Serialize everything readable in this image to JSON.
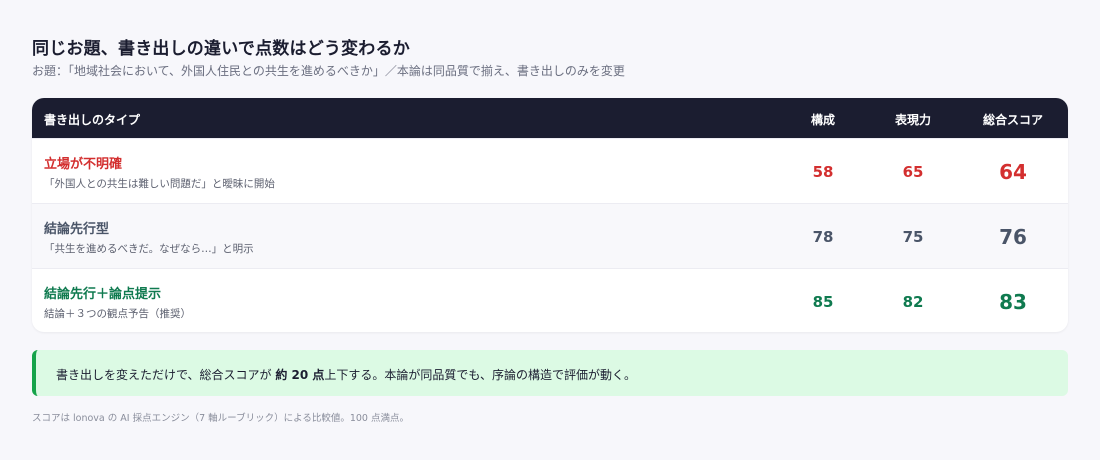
{
  "title": "同じお題、書き出しの違いで点数はどう変わるか",
  "subtitle": "お題：「地域社会において、外国人住民との共生を進めるべきか」／本論は同品質で揃え、書き出しのみを変更",
  "table": {
    "headers": {
      "type": "書き出しのタイプ",
      "structure": "構成",
      "expression": "表現力",
      "total": "総合スコア"
    },
    "rows": [
      {
        "name": "立場が不明確",
        "desc": "「外国人との共生は難しい問題だ」と曖昧に開始",
        "structure": "58",
        "expression": "65",
        "total": "64",
        "color": "#d32f2f"
      },
      {
        "name": "結論先行型",
        "desc": "「共生を進めるべきだ。なぜなら…」と明示",
        "structure": "78",
        "expression": "75",
        "total": "76",
        "color": "#4a5568"
      },
      {
        "name": "結論先行＋論点提示",
        "desc": "結論＋３つの観点予告（推奨）",
        "structure": "85",
        "expression": "82",
        "total": "83",
        "color": "#0f7a4f"
      }
    ]
  },
  "banner": {
    "before": "書き出しを変えただけで、総合スコアが ",
    "bold": "約 20 点",
    "after": "上下する。本論が同品質でも、序論の構造で評価が動く。",
    "accent": "#16a34a",
    "background": "#dcfae4"
  },
  "footnote": "スコアは lonova の AI 採点エンジン（7 軸ルーブリック）による比較値。100 点満点。"
}
